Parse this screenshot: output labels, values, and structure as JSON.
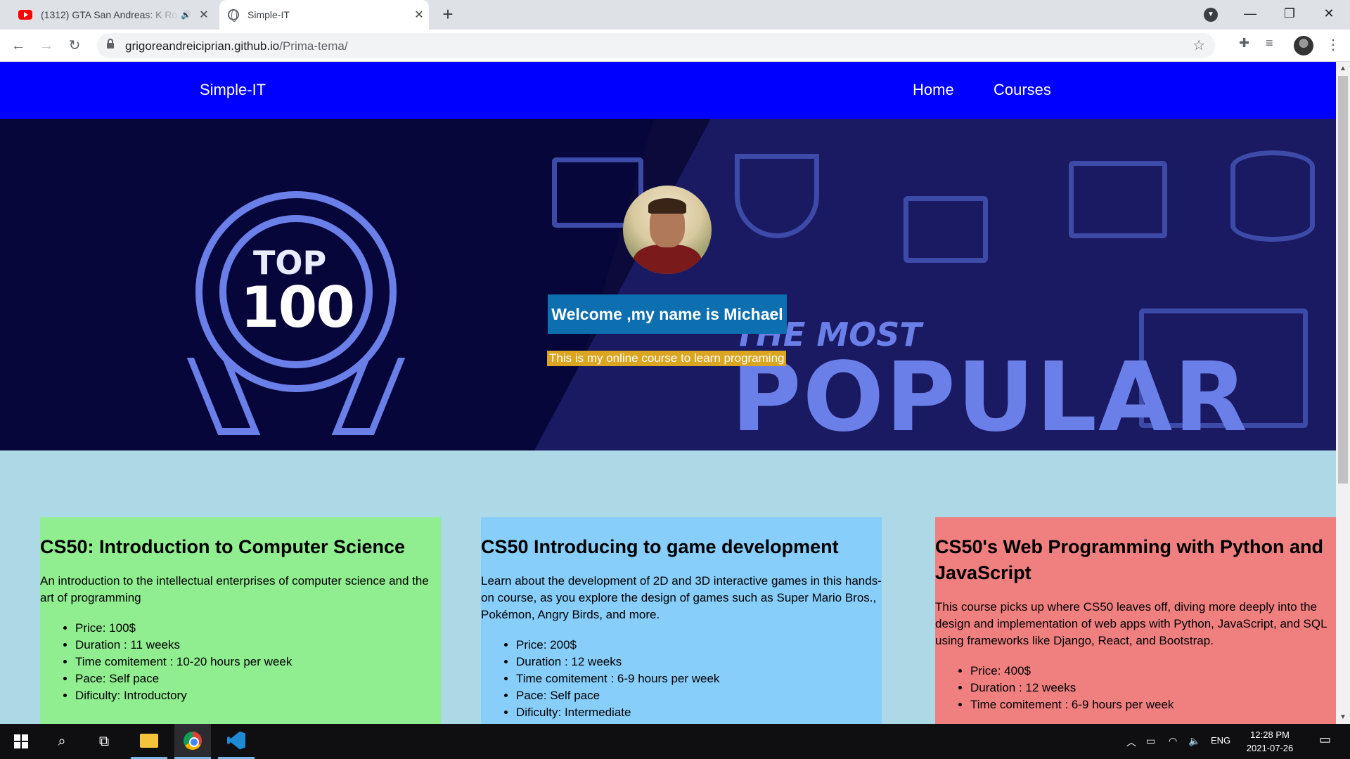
{
  "browser": {
    "tabs": [
      {
        "title": "(1312) GTA San Andreas: K Ro",
        "icon": "youtube-icon",
        "audio": true
      },
      {
        "title": "Simple-IT",
        "icon": "globe-icon",
        "active": true
      }
    ],
    "new_tab": "+",
    "window_controls": {
      "minimize": "—",
      "maximize": "❐",
      "close": "✕"
    },
    "url_host": "grigoreandreiciprian.github.io",
    "url_path": "/Prima-tema/"
  },
  "site": {
    "brand": "Simple-IT",
    "nav": [
      "Home",
      "Courses"
    ],
    "hero": {
      "badge_top": "TOP",
      "badge_number": "100",
      "banner_line1": "THE MOST",
      "banner_line2": "POPULAR",
      "welcome": "Welcome ,my name is Michael",
      "tagline": "This is my online course to learn programing"
    },
    "courses": [
      {
        "title": "CS50: Introduction to Computer Science",
        "description": "An introduction to the intellectual enterprises of computer science and the art of programming",
        "details": [
          "Price: 100$",
          "Duration : 11 weeks",
          "Time comitement : 10-20 hours per week",
          "Pace: Self pace",
          "Dificulty: Introductory"
        ],
        "color": "#90ee90"
      },
      {
        "title": "CS50 Introducing to game development",
        "description": "Learn about the development of 2D and 3D interactive games in this hands-on course, as you explore the design of games such as Super Mario Bros., Pokémon, Angry Birds, and more.",
        "details": [
          "Price: 200$",
          "Duration : 12 weeks",
          "Time comitement : 6-9 hours per week",
          "Pace: Self pace",
          "Dificulty: Intermediate"
        ],
        "color": "#87cefa"
      },
      {
        "title": "CS50's Web Programming with Python and JavaScript",
        "description": "This course picks up where CS50 leaves off, diving more deeply into the design and implementation of web apps with Python, JavaScript, and SQL using frameworks like Django, React, and Bootstrap.",
        "details": [
          "Price: 400$",
          "Duration : 12 weeks",
          "Time comitement : 6-9 hours per week"
        ],
        "color": "#f08080"
      }
    ]
  },
  "taskbar": {
    "language": "ENG",
    "time": "12:28 PM",
    "date": "2021-07-26"
  },
  "colors": {
    "site_nav": "#0000ff",
    "page_background": "#add8e6",
    "welcome_background": "#0d6eb0",
    "tagline_background": "#daa520"
  }
}
